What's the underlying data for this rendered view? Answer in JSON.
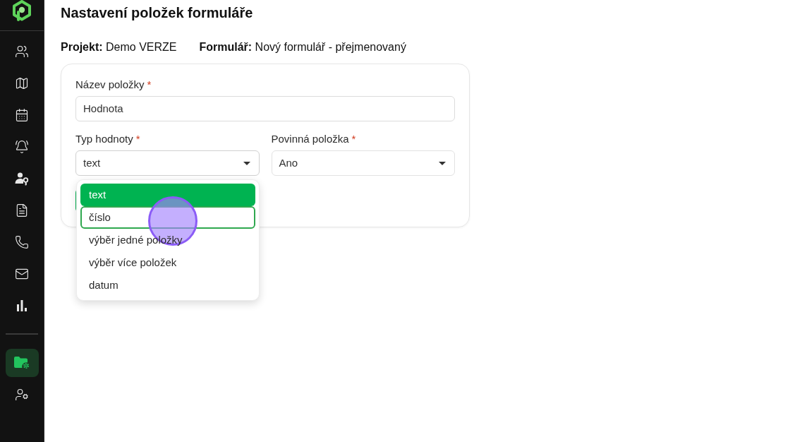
{
  "sidebar": {
    "nav_items": [
      {
        "selected": false
      },
      {
        "selected": false
      },
      {
        "selected": false
      },
      {
        "selected": false
      },
      {
        "selected": false
      },
      {
        "selected": false
      },
      {
        "selected": false
      },
      {
        "selected": false
      },
      {
        "selected": false
      }
    ],
    "bottom_items": [
      {
        "selected": true
      },
      {
        "selected": false
      }
    ]
  },
  "page": {
    "title": "Nastavení položek formuláře",
    "info": [
      "**Projekt:** Demo VERZE",
      "**Formulář:** Nový formulář - přejmenovaný"
    ]
  },
  "form": {
    "fields": [
      {
        "kind": "input",
        "label": "Název položky",
        "required_mark": "*",
        "value": "Hodnota"
      },
      {
        "kind": "select",
        "label": "Typ hodnoty",
        "required_mark": "*",
        "value": "text",
        "expanded": true,
        "options": [
          {
            "label": "text",
            "selected": true,
            "highlighted": false
          },
          {
            "label": "číslo",
            "selected": false,
            "highlighted": true
          },
          {
            "label": "výběr jedné položky",
            "selected": false,
            "highlighted": false
          },
          {
            "label": "výběr více položek",
            "selected": false,
            "highlighted": false
          },
          {
            "label": "datum",
            "selected": false,
            "highlighted": false
          }
        ]
      },
      {
        "kind": "select",
        "label": "Povinná položka",
        "required_mark": "*",
        "value": "Ano",
        "expanded": false
      }
    ]
  }
}
